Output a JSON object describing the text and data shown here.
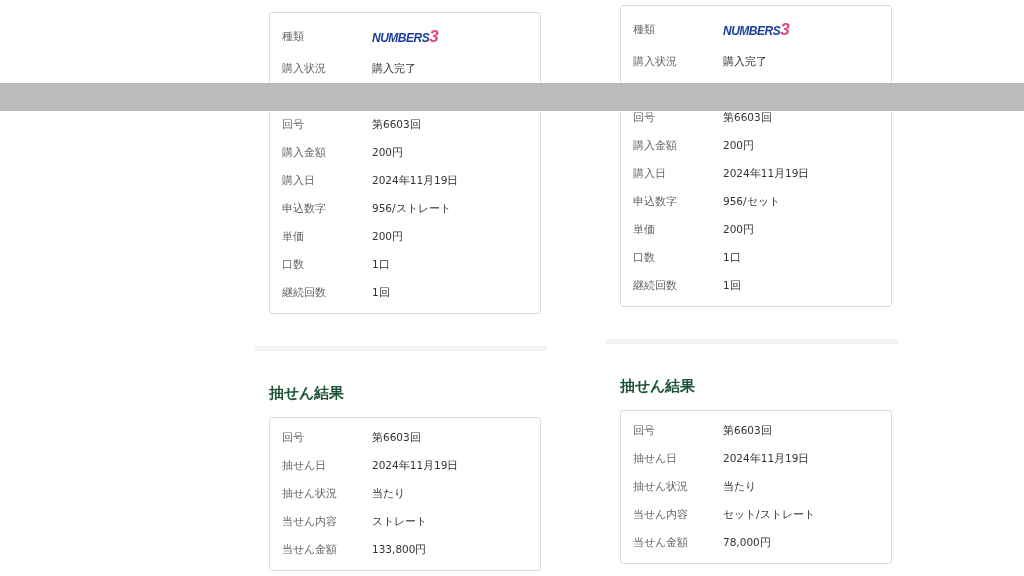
{
  "panels": [
    {
      "purchase": {
        "logo": {
          "text": "NUMBERS",
          "digit": "3"
        },
        "rows": [
          {
            "label": "種類",
            "kind": "logo"
          },
          {
            "label": "購入状況",
            "value": "購入完了",
            "kind": "text"
          },
          {
            "label": "回号",
            "value": "第6603回",
            "kind": "text"
          },
          {
            "label": "購入金額",
            "value": "200円",
            "kind": "text"
          },
          {
            "label": "購入日",
            "value": "2024年11月19日",
            "kind": "text"
          },
          {
            "label": "申込数字",
            "value": "956/ストレート",
            "kind": "text"
          },
          {
            "label": "単価",
            "value": "200円",
            "kind": "text"
          },
          {
            "label": "口数",
            "value": "1口",
            "kind": "text"
          },
          {
            "label": "継続回数",
            "value": "1回",
            "kind": "text"
          }
        ]
      },
      "result": {
        "heading": "抽せん結果",
        "rows": [
          {
            "label": "回号",
            "value": "第6603回"
          },
          {
            "label": "抽せん日",
            "value": "2024年11月19日"
          },
          {
            "label": "抽せん状況",
            "value": "当たり"
          },
          {
            "label": "当せん内容",
            "value": "ストレート"
          },
          {
            "label": "当せん金額",
            "value": "133,800円"
          }
        ]
      }
    },
    {
      "purchase": {
        "logo": {
          "text": "NUMBERS",
          "digit": "3"
        },
        "rows": [
          {
            "label": "種類",
            "kind": "logo"
          },
          {
            "label": "購入状況",
            "value": "購入完了",
            "kind": "text"
          },
          {
            "label": "回号",
            "value": "第6603回",
            "kind": "text"
          },
          {
            "label": "購入金額",
            "value": "200円",
            "kind": "text"
          },
          {
            "label": "購入日",
            "value": "2024年11月19日",
            "kind": "text"
          },
          {
            "label": "申込数字",
            "value": "956/セット",
            "kind": "text"
          },
          {
            "label": "単価",
            "value": "200円",
            "kind": "text"
          },
          {
            "label": "口数",
            "value": "1口",
            "kind": "text"
          },
          {
            "label": "継続回数",
            "value": "1回",
            "kind": "text"
          }
        ]
      },
      "result": {
        "heading": "抽せん結果",
        "rows": [
          {
            "label": "回号",
            "value": "第6603回"
          },
          {
            "label": "抽せん日",
            "value": "2024年11月19日"
          },
          {
            "label": "抽せん状況",
            "value": "当たり"
          },
          {
            "label": "当せん内容",
            "value": "セット/ストレート"
          },
          {
            "label": "当せん金額",
            "value": "78,000円"
          }
        ]
      }
    }
  ]
}
